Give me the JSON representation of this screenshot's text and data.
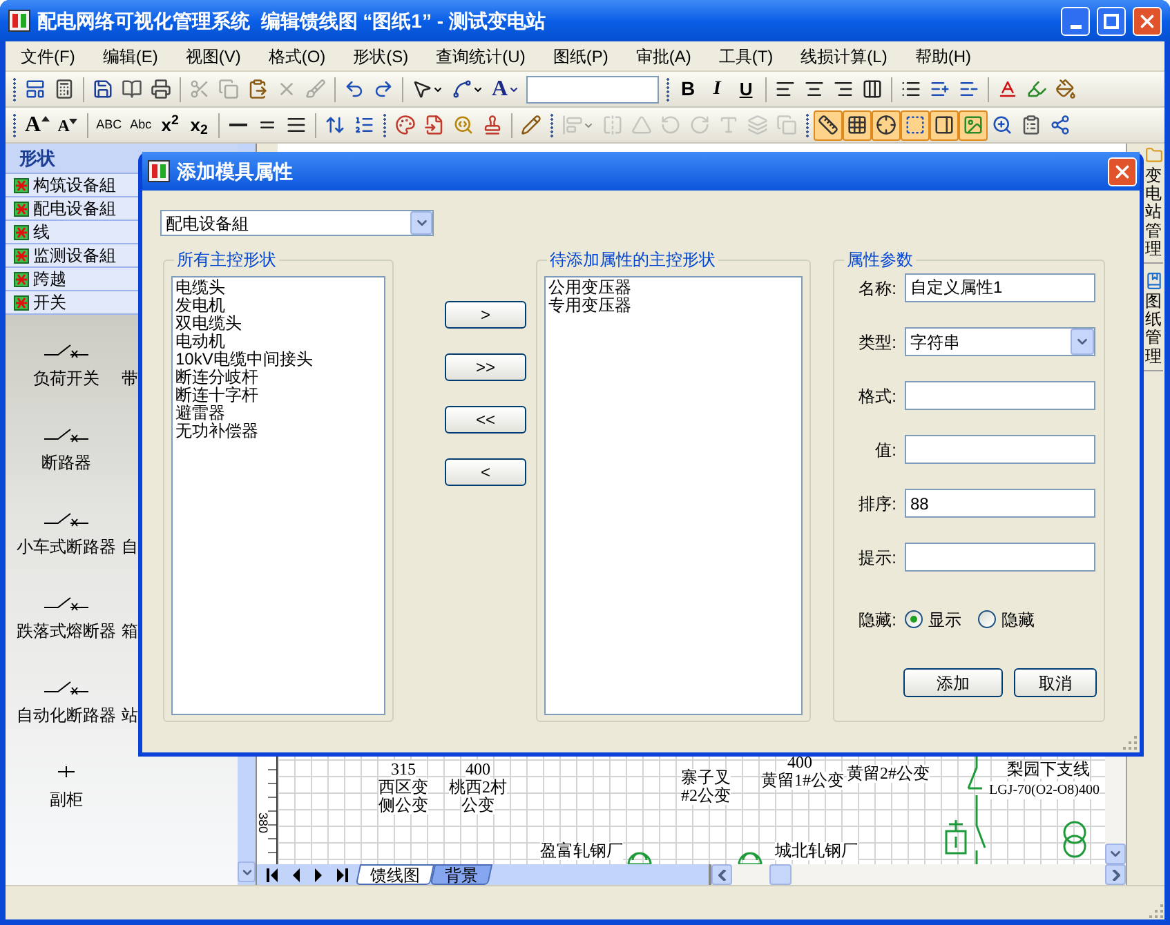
{
  "window": {
    "title": "配电网络可视化管理系统  编辑馈线图 “图纸1” - 测试变电站"
  },
  "menu": [
    "文件(F)",
    "编辑(E)",
    "视图(V)",
    "格式(O)",
    "形状(S)",
    "查询统计(U)",
    "图纸(P)",
    "审批(A)",
    "工具(T)",
    "线损计算(L)",
    "帮助(H)"
  ],
  "toolbars": [
    {
      "items": [
        {
          "kind": "grip"
        },
        {
          "kind": "icon",
          "selected": false,
          "disabled": false
        },
        {
          "kind": "icon",
          "selected": false,
          "disabled": false
        },
        {
          "kind": "separator"
        },
        {
          "kind": "icon",
          "selected": false,
          "disabled": false
        },
        {
          "kind": "icon",
          "selected": false,
          "disabled": false
        },
        {
          "kind": "icon",
          "selected": false,
          "disabled": false
        },
        {
          "kind": "separator"
        },
        {
          "kind": "icon",
          "selected": false,
          "disabled": true
        },
        {
          "kind": "icon",
          "selected": false,
          "disabled": true
        },
        {
          "kind": "icon",
          "selected": false,
          "disabled": false
        },
        {
          "kind": "icon",
          "selected": false,
          "disabled": true
        },
        {
          "kind": "icon",
          "selected": false,
          "disabled": true
        },
        {
          "kind": "separator"
        },
        {
          "kind": "icon",
          "selected": false,
          "disabled": false
        },
        {
          "kind": "icon",
          "selected": false,
          "disabled": false
        },
        {
          "kind": "separator"
        },
        {
          "kind": "icon",
          "selected": false,
          "disabled": false,
          "caret": true
        },
        {
          "kind": "icon",
          "selected": false,
          "disabled": false,
          "caret": true
        },
        {
          "kind": "text",
          "label": "A",
          "caret": true
        },
        {
          "kind": "field"
        },
        {
          "kind": "grip"
        },
        {
          "kind": "text",
          "label": "B"
        },
        {
          "kind": "text",
          "label": "I"
        },
        {
          "kind": "text",
          "label": "U"
        },
        {
          "kind": "separator"
        },
        {
          "kind": "icon",
          "selected": false,
          "disabled": false
        },
        {
          "kind": "icon",
          "selected": false,
          "disabled": false
        },
        {
          "kind": "icon",
          "selected": false,
          "disabled": false
        },
        {
          "kind": "icon",
          "selected": false,
          "disabled": false
        },
        {
          "kind": "separator"
        },
        {
          "kind": "icon",
          "selected": false,
          "disabled": false
        },
        {
          "kind": "icon",
          "selected": false,
          "disabled": false
        },
        {
          "kind": "icon",
          "selected": false,
          "disabled": false
        },
        {
          "kind": "separator"
        },
        {
          "kind": "icon",
          "selected": false,
          "disabled": false
        },
        {
          "kind": "icon",
          "selected": false,
          "disabled": false
        },
        {
          "kind": "icon",
          "selected": false,
          "disabled": false
        }
      ]
    },
    {
      "items": [
        {
          "kind": "grip"
        },
        {
          "kind": "grow",
          "label": "A"
        },
        {
          "kind": "shrink",
          "label": "A"
        },
        {
          "kind": "separator"
        },
        {
          "kind": "text",
          "label": "ABC"
        },
        {
          "kind": "text",
          "label": "Abc"
        },
        {
          "kind": "text",
          "label": "x$^{2}$"
        },
        {
          "kind": "text",
          "label": "x$_{2}$"
        },
        {
          "kind": "separator"
        },
        {
          "kind": "icon",
          "selected": false,
          "disabled": false
        },
        {
          "kind": "icon",
          "selected": false,
          "disabled": false
        },
        {
          "kind": "icon",
          "selected": false,
          "disabled": false
        },
        {
          "kind": "separator"
        },
        {
          "kind": "icon",
          "selected": false,
          "disabled": false
        },
        {
          "kind": "icon",
          "selected": false,
          "disabled": false
        },
        {
          "kind": "grip"
        },
        {
          "kind": "icon",
          "selected": false,
          "disabled": false
        },
        {
          "kind": "icon",
          "selected": false,
          "disabled": false
        },
        {
          "kind": "icon",
          "selected": false,
          "disabled": false
        },
        {
          "kind": "icon",
          "selected": false,
          "disabled": false
        },
        {
          "kind": "separator"
        },
        {
          "kind": "icon",
          "selected": false,
          "disabled": false
        },
        {
          "kind": "grip"
        },
        {
          "kind": "icon",
          "selected": false,
          "disabled": true,
          "caret": true
        },
        {
          "kind": "icon",
          "selected": false,
          "disabled": true
        },
        {
          "kind": "icon",
          "selected": false,
          "disabled": true
        },
        {
          "kind": "icon",
          "selected": false,
          "disabled": true
        },
        {
          "kind": "icon",
          "selected": false,
          "disabled": true
        },
        {
          "kind": "icon",
          "selected": false,
          "disabled": true
        },
        {
          "kind": "icon",
          "selected": false,
          "disabled": true
        },
        {
          "kind": "icon",
          "selected": false,
          "disabled": true
        },
        {
          "kind": "grip"
        },
        {
          "kind": "icon",
          "selected": true,
          "disabled": false
        },
        {
          "kind": "icon",
          "selected": true,
          "disabled": false
        },
        {
          "kind": "icon",
          "selected": true,
          "disabled": false
        },
        {
          "kind": "icon",
          "selected": true,
          "disabled": false
        },
        {
          "kind": "icon",
          "selected": true,
          "disabled": false
        },
        {
          "kind": "icon",
          "selected": true,
          "disabled": false
        },
        {
          "kind": "icon",
          "selected": false,
          "disabled": false
        },
        {
          "kind": "icon",
          "selected": false,
          "disabled": false
        },
        {
          "kind": "icon",
          "selected": false,
          "disabled": false
        }
      ]
    }
  ],
  "shapes_panel": {
    "title": "形状",
    "groups": [
      "构筑设备組",
      "配电设备組",
      "线",
      "监测设备組",
      "跨越",
      "开关"
    ],
    "shapes": [
      {
        "label": "负荷开关",
        "next": "带"
      },
      {
        "label": "断路器"
      },
      {
        "label": "小车式断路器",
        "next": "自"
      },
      {
        "label": "跌落式熔断器",
        "next": "箱"
      },
      {
        "label": "自动化断路器",
        "next": "站"
      },
      {
        "label": "副柜"
      }
    ]
  },
  "canvas": {
    "ruler_label": "380",
    "labels": [
      "315",
      "西区变",
      "侧公变",
      "400",
      "桃西2村",
      "公变",
      "寨子叉",
      "#2公变",
      "400",
      "黄留1#公变",
      "黄留2#公变",
      "梨园下支线",
      "LGJ-70(O2-O8)400",
      "盈富轧钢厂",
      "城北轧钢厂"
    ]
  },
  "sheet_tabs": [
    {
      "label": "馈线图",
      "selected": true
    },
    {
      "label": "背景",
      "selected": false
    }
  ],
  "side_tabs": [
    "变电站管理",
    "图纸管理"
  ],
  "dialog": {
    "title": "添加模具属性",
    "group_select": "配电设备組",
    "all_shapes": {
      "title": "所有主控形状",
      "items": [
        "电缆头",
        "发电机",
        "双电缆头",
        "电动机",
        "10kV电缆中间接头",
        "断连分岐杆",
        "断连十字杆",
        "避雷器",
        "无功补偿器"
      ]
    },
    "move_buttons": [
      ">",
      ">>",
      "<<",
      "<"
    ],
    "pending_shapes": {
      "title": "待添加属性的主控形状",
      "items": [
        "公用变压器",
        "专用变压器"
      ]
    },
    "properties": {
      "title": "属性参数",
      "fields": [
        {
          "kind": "text",
          "label": "名称:",
          "value": "自定义属性1"
        },
        {
          "kind": "select",
          "label": "类型:",
          "value": "字符串"
        },
        {
          "kind": "text",
          "label": "格式:"
        },
        {
          "kind": "text",
          "label": "值:"
        },
        {
          "kind": "text",
          "label": "排序:",
          "value": "88"
        },
        {
          "kind": "text",
          "label": "提示:"
        },
        {
          "kind": "radio",
          "label": "隐藏:",
          "options": [
            {
              "label": "显示",
              "selected": true
            },
            {
              "label": "隐藏",
              "selected": false
            }
          ]
        }
      ]
    },
    "buttons": [
      "添加",
      "取消"
    ]
  }
}
